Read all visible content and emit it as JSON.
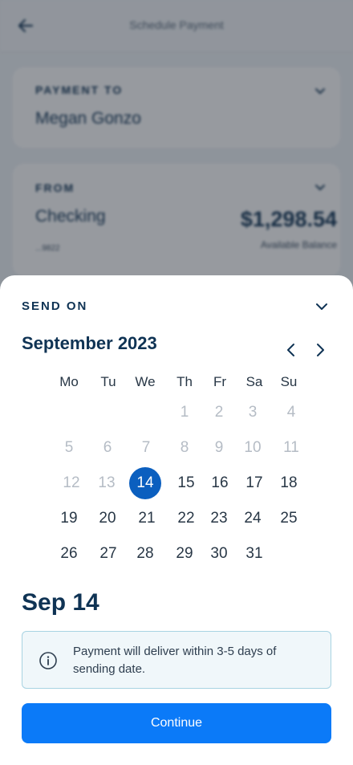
{
  "header": {
    "title": "Schedule Payment"
  },
  "payment_to": {
    "label": "PAYMENT TO",
    "value": "Megan Gonzo"
  },
  "from": {
    "label": "FROM",
    "account": "Checking",
    "account_last4": "...9822",
    "balance": "$1,298.54",
    "balance_label": "Available Balance"
  },
  "sheet": {
    "title": "SEND ON",
    "month": "September 2023",
    "weekdays": [
      "Mo",
      "Tu",
      "We",
      "Th",
      "Fr",
      "Sa",
      "Su"
    ],
    "days": [
      [
        "",
        "",
        "",
        "1",
        "2",
        "3",
        "4"
      ],
      [
        "5",
        "6",
        "7",
        "8",
        "9",
        "10",
        "11"
      ],
      [
        "12",
        "13",
        "14",
        "15",
        "16",
        "17",
        "18"
      ],
      [
        "19",
        "20",
        "21",
        "22",
        "23",
        "24",
        "25"
      ],
      [
        "26",
        "27",
        "28",
        "29",
        "30",
        "31",
        ""
      ]
    ],
    "selected_day": "14",
    "selected_label": "Sep 14",
    "info": "Payment will deliver within 3-5 days of sending date.",
    "continue_label": "Continue"
  },
  "colors": {
    "brand": "#0f3354",
    "accent": "#0b7af8",
    "selected": "#0b5fbf",
    "info_bg": "#f0f7fa",
    "info_border": "#a8d3e2",
    "muted_day": "#b5bcc5"
  },
  "icons": {
    "back": "arrow-left-icon",
    "dropdown": "chevron-down-icon",
    "prev": "chevron-left-icon",
    "next": "chevron-right-icon",
    "info": "info-icon"
  }
}
